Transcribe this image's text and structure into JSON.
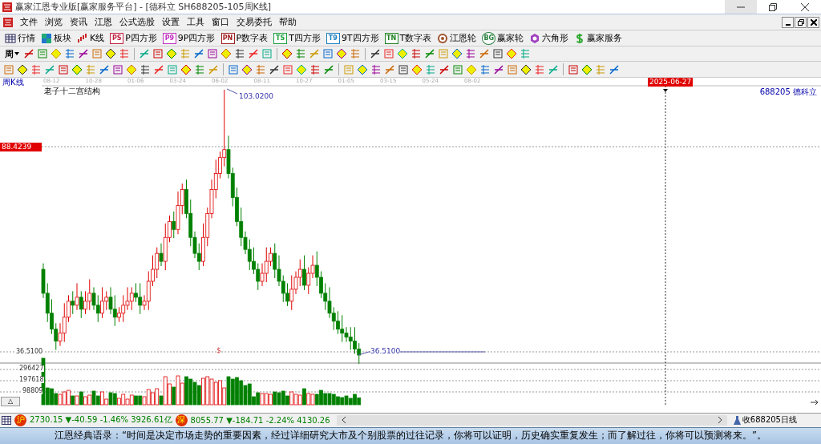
{
  "window": {
    "title": "赢家江恩专业版[赢家服务平台] - [德科立  SH688205-105周K线]"
  },
  "menu": {
    "items": [
      "文件",
      "浏览",
      "资讯",
      "江恩",
      "公式选股",
      "设置",
      "工具",
      "窗口",
      "交易委托",
      "帮助"
    ]
  },
  "toolbar": {
    "items": [
      {
        "kind": "grid",
        "label": "行情"
      },
      {
        "kind": "blocks",
        "label": "板块"
      },
      {
        "kind": "candles",
        "label": "K线"
      },
      {
        "kind": "badge",
        "badge": "PS",
        "label": "P四方形",
        "color": "#c02040"
      },
      {
        "kind": "badge",
        "badge": "P9",
        "label": "9P四方形",
        "color": "#c030c0"
      },
      {
        "kind": "badge",
        "badge": "PN",
        "label": "P数字表",
        "color": "#a02020"
      },
      {
        "kind": "badge",
        "badge": "TS",
        "label": "T四方形",
        "color": "#20a040"
      },
      {
        "kind": "badge",
        "badge": "T9",
        "label": "9T四方形",
        "color": "#2080c0"
      },
      {
        "kind": "badge",
        "badge": "TN",
        "label": "T数字表",
        "color": "#208020"
      },
      {
        "kind": "wheel",
        "label": "江恩轮"
      },
      {
        "kind": "coin",
        "badge": "BG",
        "label": "赢家轮"
      },
      {
        "kind": "hexagon",
        "label": "六角形"
      },
      {
        "kind": "dollar",
        "label": "赢家服务"
      }
    ]
  },
  "period_selector": {
    "value": "周"
  },
  "chart": {
    "period_label": "周K线",
    "indicator_title": "老子十二宫结构",
    "date_axis": [
      "08-12",
      "10-28",
      "01-06",
      "03-24",
      "06-02",
      "08-11",
      "10-27",
      "01-05",
      "03-15",
      "05-24",
      "08-02"
    ],
    "cursor_date": "2025-06-27",
    "stock": "688205 德科立",
    "price_marker": "88.4239",
    "high_label": "103.0200",
    "low_axis_label": "36.5100",
    "low_label": "36.5100",
    "mark": "$"
  },
  "volume": {
    "axis_labels": [
      "296427",
      "197618",
      "98809"
    ],
    "toggle": "△"
  },
  "status_bar": {
    "indices": [
      {
        "badge": "沪",
        "price": "2730.15",
        "change": "▼-40.59",
        "percent": "-1.46%",
        "amount": "3926.61亿"
      },
      {
        "badge": "深",
        "price": "8055.77",
        "change": "▼-184.71",
        "percent": "-2.24%",
        "amount": "4130.26"
      }
    ],
    "right": "收688205日线"
  },
  "quote_bar": {
    "text": "江恩经典语录：“时间是决定市场走势的重要因素，经过详细研究大市及个别股票的过往记录，你将可以证明，历史确实重复发生；而了解过往，你将可以预测将来。”。"
  }
}
